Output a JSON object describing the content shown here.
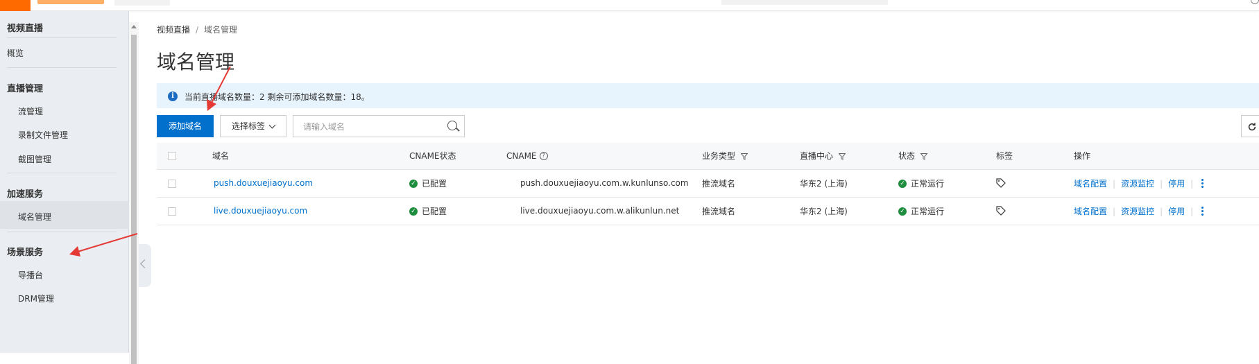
{
  "sidebar": {
    "groups": [
      {
        "title": "视频直播",
        "items": [
          "概览"
        ]
      },
      {
        "title": "直播管理",
        "items": [
          "流管理",
          "录制文件管理",
          "截图管理"
        ]
      },
      {
        "title": "加速服务",
        "items": [
          "域名管理"
        ]
      },
      {
        "title": "场景服务",
        "items": [
          "导播台",
          "DRM管理"
        ]
      }
    ],
    "active_item": "域名管理"
  },
  "breadcrumb": {
    "root": "视频直播",
    "separator": "/",
    "current": "域名管理"
  },
  "page_title": "域名管理",
  "alert": {
    "text": "当前直播域名数量：2 剩余可添加域名数量：18。",
    "icon": "info-icon"
  },
  "toolbar": {
    "add_label": "添加域名",
    "select_tag_label": "选择标签",
    "search_placeholder": "请输入域名",
    "refresh_icon": "refresh-icon"
  },
  "table": {
    "headers": {
      "domain": "域名",
      "cname_status": "CNAME状态",
      "cname": "CNAME",
      "business_type": "业务类型",
      "live_center": "直播中心",
      "status": "状态",
      "tag": "标签",
      "actions": "操作"
    },
    "rows": [
      {
        "domain": "push.douxuejiaoyu.com",
        "cname_status": "已配置",
        "cname": "push.douxuejiaoyu.com.w.kunlunso.com",
        "business_type": "推流域名",
        "live_center": "华东2 (上海)",
        "status": "正常运行"
      },
      {
        "domain": "live.douxuejiaoyu.com",
        "cname_status": "已配置",
        "cname": "live.douxuejiaoyu.com.w.alikunlun.net",
        "business_type": "推流域名",
        "live_center": "华东2 (上海)",
        "status": "正常运行"
      }
    ],
    "actions": {
      "config": "域名配置",
      "monitor": "资源监控",
      "disable": "停用"
    }
  },
  "colors": {
    "primary": "#0070cc",
    "success": "#1e8e3e",
    "alert_bg": "#e8f4fd",
    "annotation": "#e53935"
  }
}
